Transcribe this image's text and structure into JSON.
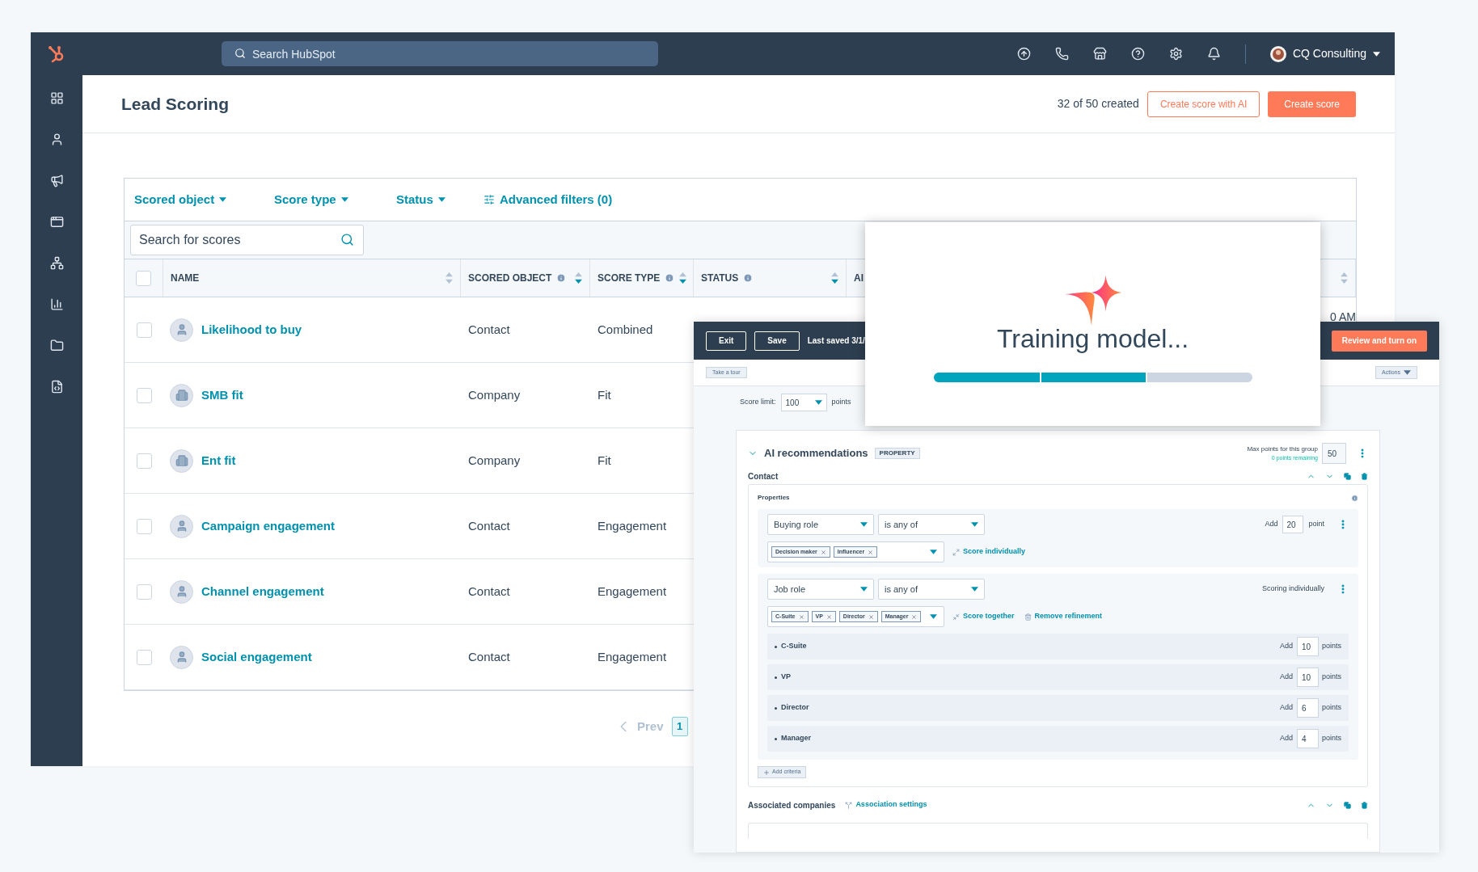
{
  "top_nav": {
    "search_placeholder": "Search HubSpot",
    "account": "CQ Consulting"
  },
  "page": {
    "title": "Lead Scoring",
    "usage": "32 of 50 created",
    "secondary_button": "Create score with AI",
    "primary_button": "Create score"
  },
  "filters": [
    "Scored object",
    "Score type",
    "Status"
  ],
  "advanced_filters": "Advanced filters (0)",
  "search": {
    "placeholder": "Search for scores"
  },
  "table": {
    "header_checked": false,
    "columns": [
      {
        "label": "NAME",
        "info": false,
        "sort_active": false
      },
      {
        "label": "SCORED OBJECT",
        "info": true,
        "sort_active": true
      },
      {
        "label": "SCORE TYPE",
        "info": true,
        "sort_active": true
      },
      {
        "label": "STATUS",
        "info": true,
        "sort_active": true
      },
      {
        "label": "AI"
      },
      {
        "sort_active": false
      }
    ],
    "rows": [
      {
        "checked": false,
        "kind": "person",
        "name": "Likelihood to buy",
        "scored_object": "Contact",
        "score_type": "Combined",
        "column_6": "0 AM"
      },
      {
        "checked": false,
        "kind": "company",
        "name": "SMB fit",
        "scored_object": "Company",
        "score_type": "Fit"
      },
      {
        "checked": false,
        "kind": "company",
        "name": "Ent fit",
        "scored_object": "Company",
        "score_type": "Fit"
      },
      {
        "checked": false,
        "kind": "person",
        "name": "Campaign engagement",
        "scored_object": "Contact",
        "score_type": "Engagement"
      },
      {
        "checked": false,
        "kind": "person",
        "name": "Channel engagement",
        "scored_object": "Contact",
        "score_type": "Engagement"
      },
      {
        "checked": false,
        "kind": "person",
        "name": "Social engagement",
        "scored_object": "Contact",
        "score_type": "Engagement"
      }
    ]
  },
  "pagination": {
    "prev": "Prev",
    "pages": [
      {
        "label": "1",
        "selected": true
      }
    ]
  },
  "editor": {
    "exit": "Exit",
    "save": "Save",
    "last_saved": "Last saved 3/1/",
    "primary": "Review and turn on",
    "tour": "Take a tour",
    "actions": "Actions",
    "score_limit_label": "Score limit:",
    "score_limit": "100",
    "points_label": "points",
    "group": {
      "title": "AI recommendations",
      "badge": "PROPERTY",
      "expanded": true,
      "max_label": "Max points for this group",
      "remaining": "0 points remaining",
      "max": "50",
      "section": "Contact",
      "properties_label": "Properties",
      "criteria": [
        {
          "kind": "together",
          "property": "Buying role",
          "operator": "is any of",
          "tags": [
            "Decision maker",
            "Influencer"
          ],
          "add_label": "Add",
          "points": "20",
          "unit": "point",
          "actions": [
            {
              "kind": "split",
              "label": "Score individually"
            }
          ]
        },
        {
          "kind": "individual",
          "property": "Job role",
          "operator": "is any of",
          "tags": [
            "C-Suite",
            "VP",
            "Director",
            "Manager"
          ],
          "status": "Scoring individually",
          "actions": [
            {
              "kind": "merge",
              "label": "Score together"
            },
            {
              "kind": "remove",
              "label": "Remove refinement"
            }
          ],
          "refinements": [
            {
              "label": "C-Suite",
              "add_label": "Add",
              "points": "10",
              "unit": "points"
            },
            {
              "label": "VP",
              "add_label": "Add",
              "points": "10",
              "unit": "points"
            },
            {
              "label": "Director",
              "add_label": "Add",
              "points": "6",
              "unit": "points"
            },
            {
              "label": "Manager",
              "add_label": "Add",
              "points": "4",
              "unit": "points"
            }
          ]
        }
      ],
      "add_criteria": "Add criteria"
    },
    "associated": {
      "title": "Associated companies",
      "link": "Association settings"
    }
  },
  "modal": {
    "title": "Training model...",
    "level": 0.67
  }
}
